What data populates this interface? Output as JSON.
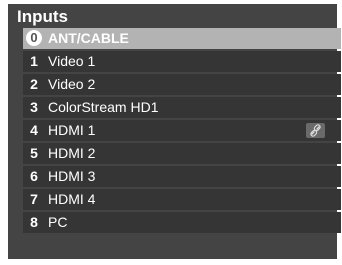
{
  "menu": {
    "title": "Inputs",
    "items": [
      {
        "number": "0",
        "label": "ANT/CABLE",
        "selected": true
      },
      {
        "number": "1",
        "label": "Video 1"
      },
      {
        "number": "2",
        "label": "Video 2"
      },
      {
        "number": "3",
        "label": "ColorStream HD1"
      },
      {
        "number": "4",
        "label": "HDMI 1",
        "icon": "link-icon"
      },
      {
        "number": "5",
        "label": "HDMI 2"
      },
      {
        "number": "6",
        "label": "HDMI 3"
      },
      {
        "number": "7",
        "label": "HDMI 4"
      },
      {
        "number": "8",
        "label": "PC"
      }
    ]
  },
  "colors": {
    "panel_background": "#444444",
    "row_background": "#353535",
    "selected_row": "#b3b3b3",
    "text": "#ffffff"
  }
}
